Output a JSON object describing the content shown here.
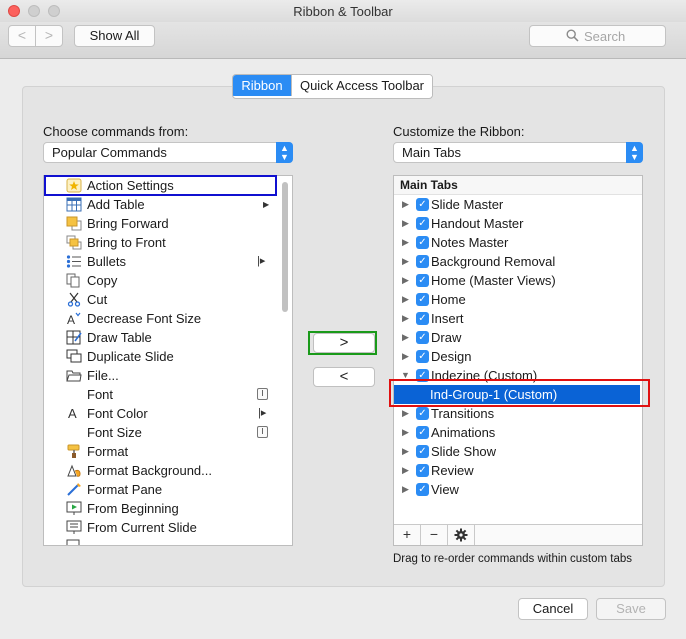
{
  "window": {
    "title": "Ribbon & Toolbar"
  },
  "toolbar": {
    "back_label": "<",
    "forward_label": ">",
    "show_all_label": "Show All",
    "search_placeholder": "Search"
  },
  "tabs": [
    {
      "label": "Ribbon",
      "active": true
    },
    {
      "label": "Quick Access Toolbar",
      "active": false
    }
  ],
  "left": {
    "label": "Choose commands from:",
    "dropdown_value": "Popular Commands",
    "items": [
      {
        "label": "Action Settings",
        "icon": "star-icon"
      },
      {
        "label": "Add Table",
        "icon": "table-icon",
        "submenu": true
      },
      {
        "label": "Bring Forward",
        "icon": "bring-forward-icon"
      },
      {
        "label": "Bring to Front",
        "icon": "bring-to-front-icon"
      },
      {
        "label": "Bullets",
        "icon": "bullets-icon",
        "menu": true
      },
      {
        "label": "Copy",
        "icon": "copy-icon"
      },
      {
        "label": "Cut",
        "icon": "scissors-icon"
      },
      {
        "label": "Decrease Font Size",
        "icon": "decrease-font-icon"
      },
      {
        "label": "Draw Table",
        "icon": "draw-table-icon"
      },
      {
        "label": "Duplicate Slide",
        "icon": "duplicate-slide-icon"
      },
      {
        "label": "File...",
        "icon": "folder-icon"
      },
      {
        "label": "Font",
        "icon": "",
        "menu": true
      },
      {
        "label": "Font Color",
        "icon": "font-color-icon",
        "menu": true
      },
      {
        "label": "Font Size",
        "icon": "",
        "menu": true
      },
      {
        "label": "Format",
        "icon": "format-painter-icon"
      },
      {
        "label": "Format Background...",
        "icon": "format-background-icon"
      },
      {
        "label": "Format Pane",
        "icon": "format-pane-icon"
      },
      {
        "label": "From Beginning",
        "icon": "slideshow-beginning-icon"
      },
      {
        "label": "From Current Slide",
        "icon": "slideshow-current-icon"
      }
    ]
  },
  "move_buttons": {
    "add_label": ">",
    "remove_label": "<"
  },
  "right": {
    "label": "Customize the Ribbon:",
    "dropdown_value": "Main Tabs",
    "header": "Main Tabs",
    "items": [
      {
        "label": "Slide Master",
        "expanded": false,
        "checked": true
      },
      {
        "label": "Handout Master",
        "expanded": false,
        "checked": true
      },
      {
        "label": "Notes Master",
        "expanded": false,
        "checked": true
      },
      {
        "label": "Background Removal",
        "expanded": false,
        "checked": true
      },
      {
        "label": "Home (Master Views)",
        "expanded": false,
        "checked": true
      },
      {
        "label": "Home",
        "expanded": false,
        "checked": true
      },
      {
        "label": "Insert",
        "expanded": false,
        "checked": true
      },
      {
        "label": "Draw",
        "expanded": false,
        "checked": true
      },
      {
        "label": "Design",
        "expanded": false,
        "checked": true
      },
      {
        "label": "Indezine (Custom)",
        "expanded": true,
        "checked": true
      },
      {
        "label": "Ind-Group-1 (Custom)",
        "selected": true,
        "child": true
      },
      {
        "label": "Transitions",
        "expanded": false,
        "checked": true
      },
      {
        "label": "Animations",
        "expanded": false,
        "checked": true
      },
      {
        "label": "Slide Show",
        "expanded": false,
        "checked": true
      },
      {
        "label": "Review",
        "expanded": false,
        "checked": true
      },
      {
        "label": "View",
        "expanded": false,
        "checked": true
      }
    ],
    "bottom_buttons": {
      "add": "+",
      "remove": "−",
      "settings": "gear-icon"
    }
  },
  "hint": "Drag to re-order commands within custom tabs",
  "footer": {
    "cancel_label": "Cancel",
    "save_label": "Save"
  },
  "colors": {
    "accent": "#2b8cf4",
    "selection": "#0a63d6",
    "highlight_blue": "#1010d0",
    "highlight_green": "#1a9a1a",
    "highlight_red": "#e01010"
  }
}
